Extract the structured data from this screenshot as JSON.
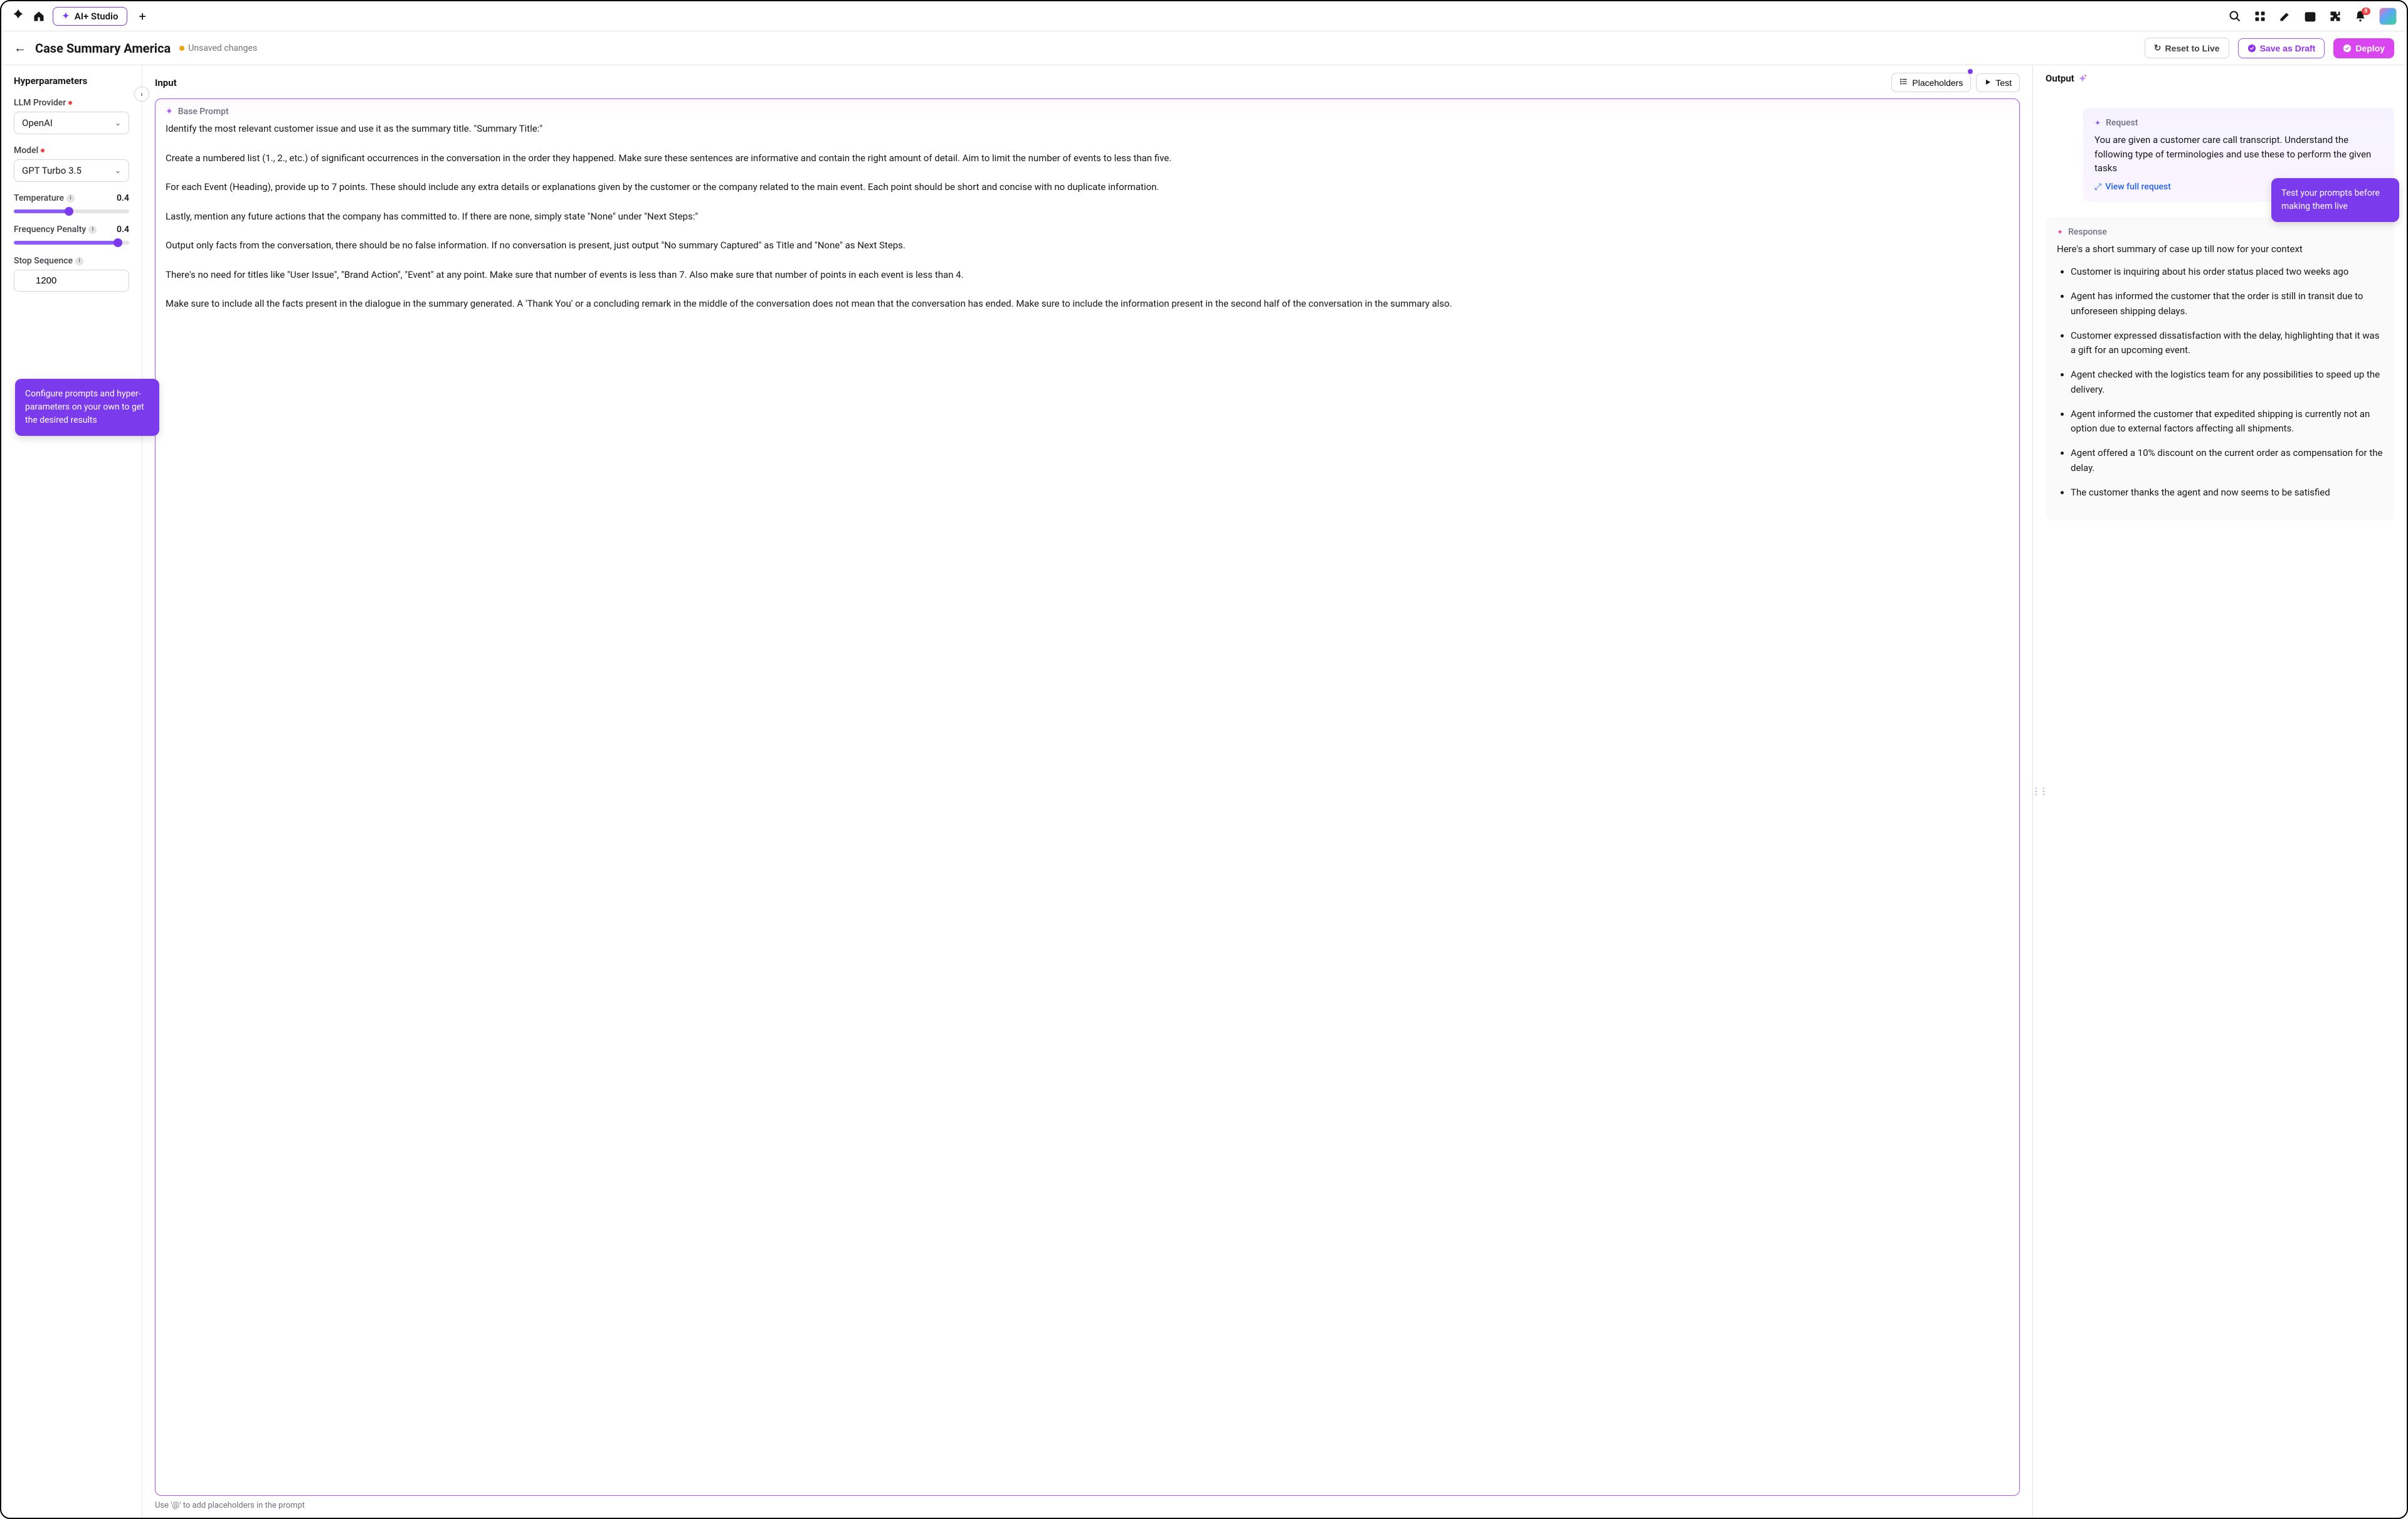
{
  "topnav": {
    "tab_label": "AI+ Studio",
    "notification_count": "8"
  },
  "subheader": {
    "title": "Case Summary America",
    "unsaved_label": "Unsaved changes",
    "reset_label": "Reset to Live",
    "draft_label": "Save as Draft",
    "deploy_label": "Deploy"
  },
  "hyper": {
    "section_title": "Hyperparameters",
    "provider_label": "LLM Provider",
    "provider_value": "OpenAI",
    "model_label": "Model",
    "model_value": "GPT Turbo 3.5",
    "temp_label": "Temperature",
    "temp_value": "0.4",
    "temp_fill_pct": 48,
    "freq_label": "Frequency Penalty",
    "freq_value": "0.4",
    "freq_fill_pct": 90,
    "stop_label": "Stop Sequence",
    "stop_value": "1200",
    "tip_text": "Configure prompts and hyper-parameters on your own to get the desired results"
  },
  "input": {
    "section_title": "Input",
    "placeholders_btn": "Placeholders",
    "test_btn": "Test",
    "base_prompt_label": "Base Prompt",
    "prompt_text": "Identify the most relevant customer issue and use it as the summary title. \"Summary Title:\"\n\nCreate a numbered list (1., 2., etc.) of significant occurrences in the conversation in the order they happened. Make sure these sentences are informative and contain the right amount of detail. Aim to limit the number of events to less than five.\n\nFor each Event (Heading), provide up to 7 points. These should include any extra details or explanations given by the customer or the company related to the main event. Each point should be short and concise with no duplicate information.\n\nLastly, mention any future actions that the company has committed to. If there are none, simply state \"None\" under \"Next Steps:\"\n\nOutput only facts from the conversation, there should be no false information. If no conversation is present, just output \"No summary Captured\" as Title and \"None\" as Next Steps.\n\nThere's no need for titles like \"User Issue\", \"Brand Action\", \"Event\" at any point. Make sure that number of events is less than 7. Also make sure that number of points in each event is less than 4.\n\nMake sure to include all the facts present in the dialogue in the summary generated. A 'Thank You' or a concluding remark in the middle of the conversation does not mean that the conversation has ended. Make sure to include the information present in the second half of the conversation in the summary also.",
    "hint": "Use '@' to add placeholders in the prompt"
  },
  "output": {
    "section_title": "Output",
    "request_label": "Request",
    "request_text": "You are given a customer care call transcript. Understand the following type of terminologies and use these to perform the given tasks",
    "view_full_label": "View full request",
    "response_label": "Response",
    "response_intro": "Here's a short summary of case up till now for your context",
    "items": [
      "Customer is inquiring about his order status placed two weeks ago",
      "Agent has informed the customer that the order is still in transit due to unforeseen shipping delays.",
      "Customer expressed dissatisfaction with the delay, highlighting that it was a gift for an upcoming event.",
      "Agent checked with the logistics team for any possibilities to speed up the delivery.",
      "Agent informed the customer that expedited shipping is currently not an option due to external factors affecting all shipments.",
      "Agent offered a 10% discount on the current order as compensation for the delay.",
      "The customer thanks the agent and now seems to be satisfied"
    ],
    "tip_text": "Test your prompts before making them live"
  }
}
